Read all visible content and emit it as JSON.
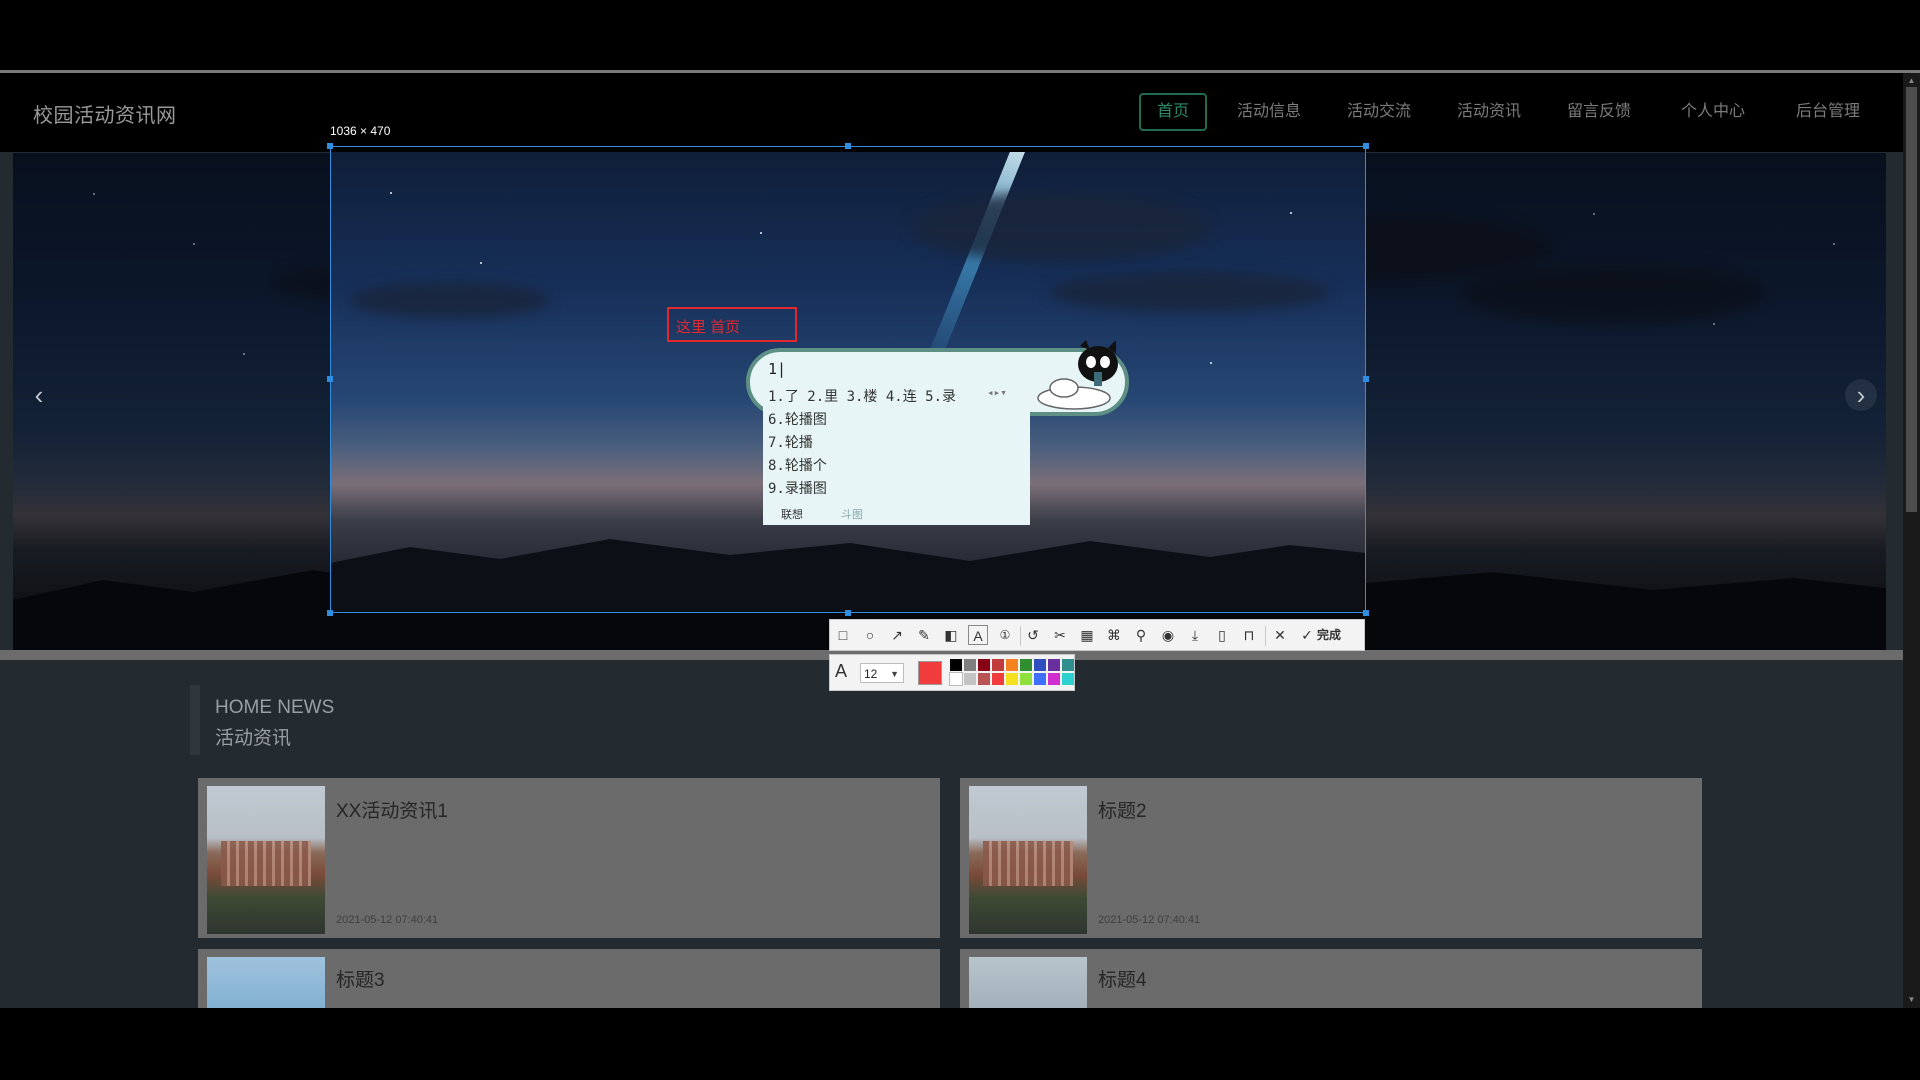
{
  "site": {
    "title": "校园活动资讯网",
    "nav": [
      "首页",
      "活动信息",
      "活动交流",
      "活动资讯",
      "留言反馈",
      "个人中心",
      "后台管理"
    ],
    "active_nav": "首页"
  },
  "carousel": {
    "prev_icon": "‹",
    "next_icon": "›"
  },
  "news": {
    "heading_en": "HOME NEWS",
    "heading_cn": "活动资讯",
    "items": [
      {
        "title": "XX活动资讯1",
        "date": "2021-05-12 07:40:41"
      },
      {
        "title": "标题2",
        "date": "2021-05-12 07:40:41"
      },
      {
        "title": "标题3"
      },
      {
        "title": "标题4"
      }
    ]
  },
  "capture": {
    "size_label": "1036 × 470",
    "text_annotation": "这里 首页",
    "ime": {
      "code": "1|",
      "row1": "1.了 2.里 3.楼 4.连 5.录",
      "candidates": [
        "6.轮播图",
        "7.轮播",
        "8.轮播个",
        "9.录播图"
      ],
      "tab_active": "联想",
      "tab_inactive": "斗图"
    },
    "toolbar": {
      "icons": [
        "rectangle-icon",
        "ellipse-icon",
        "arrow-icon",
        "pencil-icon",
        "mosaic-icon",
        "text-icon",
        "number-icon",
        "undo-icon",
        "crop-icon",
        "ocr-icon",
        "translate-icon",
        "pin-icon",
        "record-icon",
        "download-icon",
        "long-capture-icon",
        "bookmark-icon",
        "close-icon"
      ],
      "done_label": "完成"
    },
    "palette": {
      "font_glyph": "A",
      "font_size": "12",
      "current_color": "#f03c3c",
      "colors_top": [
        "#000000",
        "#7f7f7f",
        "#880015",
        "#c13c3c",
        "#f58220",
        "#2f8f2f",
        "#2f4fbf",
        "#6a2f9f",
        "#2f8f8f"
      ],
      "colors_bottom": [
        "#ffffff",
        "#c3c3c3",
        "#b85454",
        "#f03c3c",
        "#f5e020",
        "#8fdf3f",
        "#3f6fff",
        "#d02fd0",
        "#2fd0d0"
      ]
    }
  }
}
